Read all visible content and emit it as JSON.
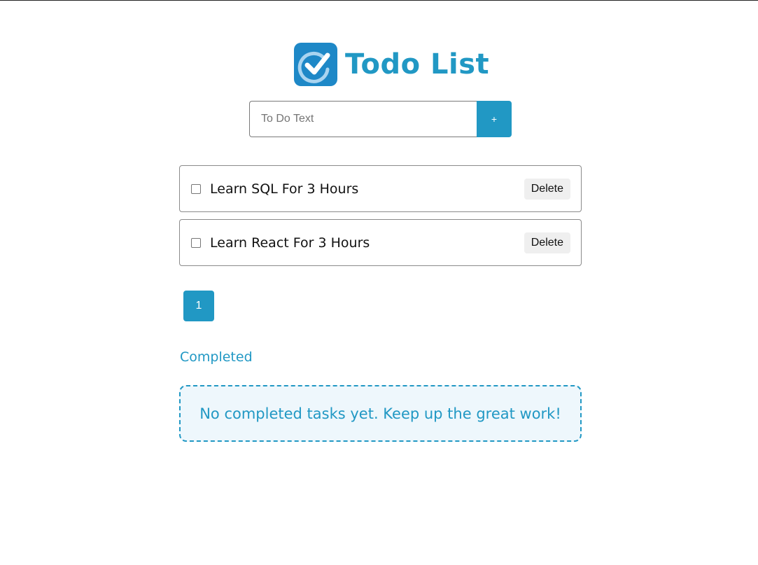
{
  "app": {
    "title": "Todo List",
    "logo_icon": "check-circle-icon",
    "accent_color": "#2198c4"
  },
  "add_form": {
    "placeholder": "To Do Text",
    "value": "",
    "add_label": "+"
  },
  "tasks": [
    {
      "label": "Learn SQL For 3 Hours",
      "checked": false,
      "delete_label": "Delete"
    },
    {
      "label": "Learn React For 3 Hours",
      "checked": false,
      "delete_label": "Delete"
    }
  ],
  "pagination": {
    "current_page": "1"
  },
  "completed": {
    "heading": "Completed",
    "empty_message": "No completed tasks yet. Keep up the great work!"
  }
}
